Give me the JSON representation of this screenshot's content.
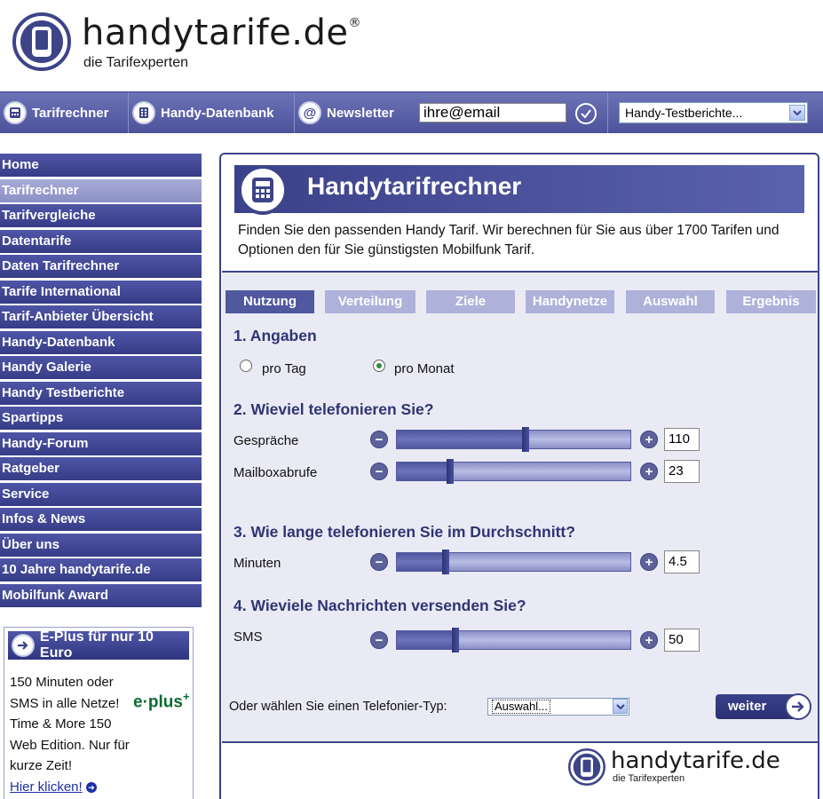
{
  "brand": {
    "name": "handytarife.de",
    "registered": "®",
    "tagline": "die Tarifexperten"
  },
  "topnav": {
    "items": [
      {
        "label": "Tarifrechner",
        "icon": "calculator-icon"
      },
      {
        "label": "Handy-Datenbank",
        "icon": "database-icon"
      },
      {
        "label": "Newsletter",
        "icon": "at-icon"
      }
    ],
    "newsletter_value": "ihre@email",
    "test_select": "Handy-Testberichte..."
  },
  "sidebar": {
    "items": [
      {
        "label": "Home"
      },
      {
        "label": "Tarifrechner"
      },
      {
        "label": "Tarifvergleiche"
      },
      {
        "label": "Datentarife"
      },
      {
        "label": "Daten Tarifrechner"
      },
      {
        "label": "Tarife International"
      },
      {
        "label": "Tarif-Anbieter Übersicht"
      },
      {
        "label": "Handy-Datenbank"
      },
      {
        "label": "Handy Galerie"
      },
      {
        "label": "Handy Testberichte"
      },
      {
        "label": "Spartipps"
      },
      {
        "label": "Handy-Forum"
      },
      {
        "label": "Ratgeber"
      },
      {
        "label": "Service"
      },
      {
        "label": "Infos & News"
      },
      {
        "label": "Über uns"
      },
      {
        "label": "10 Jahre handytarife.de"
      },
      {
        "label": "Mobilfunk Award"
      }
    ],
    "active": "Tarifrechner"
  },
  "promo": {
    "title": "E-Plus für nur 10 Euro",
    "text": "150 Minuten oder SMS in alle Netze! Time & More 150 Web Edition. Nur für kurze Zeit!",
    "link": "Hier klicken!",
    "logo_text": "e·plus"
  },
  "main": {
    "title": "Handytarifrechner",
    "description": "Finden Sie den passenden Handy Tarif. Wir berechnen für Sie aus über 1700 Tarifen und Optionen den für Sie günstigsten Mobilfunk Tarif.",
    "tabs": [
      {
        "label": "Nutzung"
      },
      {
        "label": "Verteilung"
      },
      {
        "label": "Ziele"
      },
      {
        "label": "Handynetze"
      },
      {
        "label": "Auswahl"
      },
      {
        "label": "Ergebnis"
      }
    ],
    "active_tab": "Nutzung",
    "section1": {
      "heading": "1. Angaben",
      "radio_day": "pro Tag",
      "radio_month": "pro Monat",
      "selected": "pro Monat"
    },
    "section2": {
      "heading": "2. Wieviel telefonieren Sie?",
      "calls_label": "Gespräche",
      "calls_value": "110",
      "calls_level": 0.55,
      "mailbox_label": "Mailboxabrufe",
      "mailbox_value": "23",
      "mailbox_level": 0.23
    },
    "section3": {
      "heading": "3. Wie lange telefonieren Sie im Durchschnitt?",
      "minutes_label": "Minuten",
      "minutes_value": "4.5",
      "minutes_level": 0.21
    },
    "section4": {
      "heading": "4. Wieviele Nachrichten versenden Sie?",
      "sms_label": "SMS",
      "sms_value": "50",
      "sms_level": 0.25
    },
    "type_label": "Oder wählen Sie einen Telefonier-Typ:",
    "type_select": "Auswahl...",
    "next_label": "weiter"
  }
}
